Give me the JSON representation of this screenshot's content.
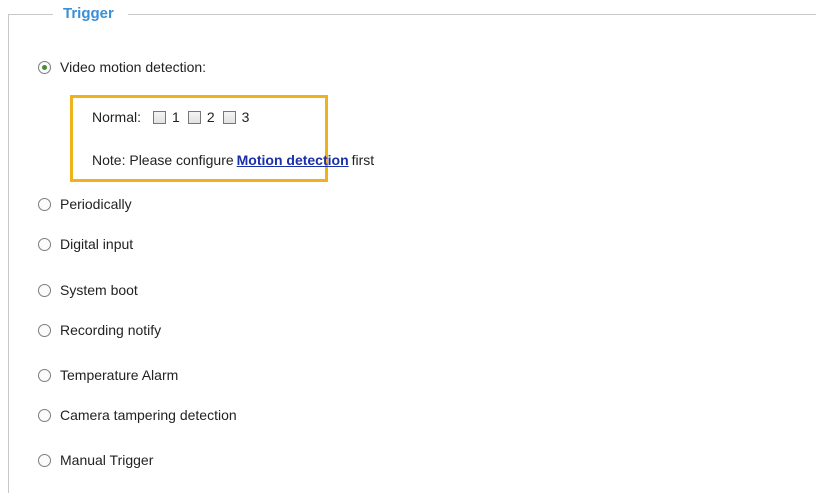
{
  "section": {
    "legend": "Trigger",
    "accent_color": "#3a8fd6",
    "highlight_color": "#f0b21b"
  },
  "options": [
    {
      "label": "Video motion detection:",
      "checked": true
    },
    {
      "label": "Periodically",
      "checked": false
    },
    {
      "label": "Digital input",
      "checked": false
    },
    {
      "label": "System boot",
      "checked": false
    },
    {
      "label": "Recording notify",
      "checked": false
    },
    {
      "label": "Temperature Alarm",
      "checked": false
    },
    {
      "label": "Camera tampering detection",
      "checked": false
    },
    {
      "label": "Manual Trigger",
      "checked": false
    }
  ],
  "motion": {
    "normal_label": "Normal:",
    "windows": [
      {
        "label": "1",
        "checked": false
      },
      {
        "label": "2",
        "checked": false
      },
      {
        "label": "3",
        "checked": false
      }
    ],
    "note_prefix": "Note: Please configure",
    "note_link": "Motion detection",
    "note_suffix": "first"
  }
}
